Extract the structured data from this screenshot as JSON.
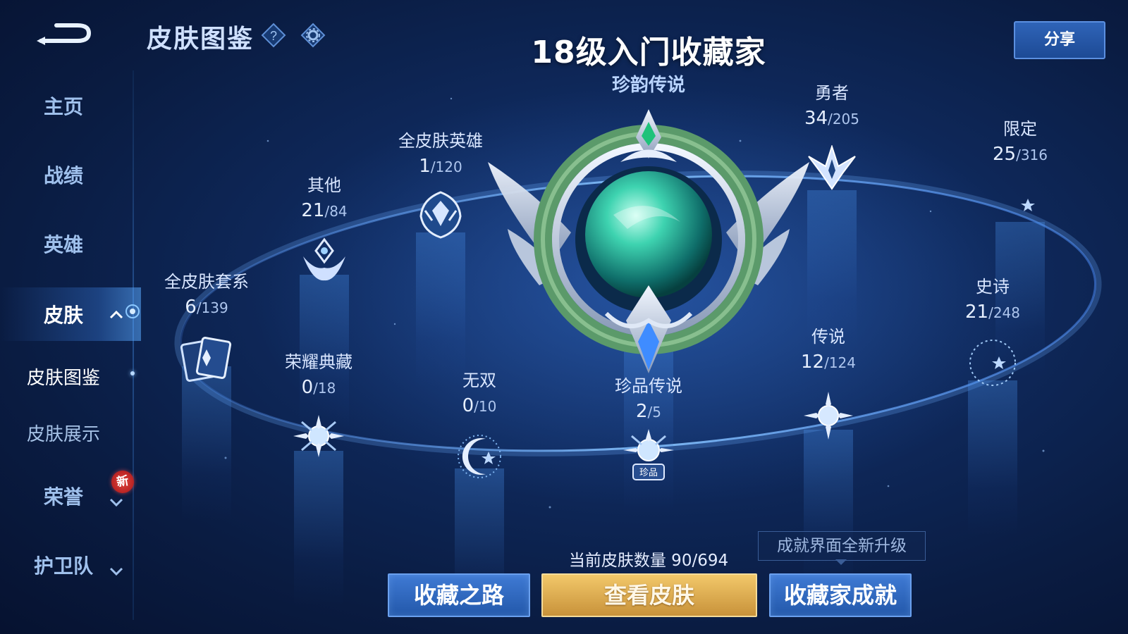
{
  "header": {
    "title": "皮肤图鉴",
    "share_label": "分享",
    "icons": [
      "back-icon",
      "help-icon",
      "settings-icon"
    ]
  },
  "sidebar": {
    "items": [
      {
        "label": "主页"
      },
      {
        "label": "战绩"
      },
      {
        "label": "英雄"
      },
      {
        "label": "皮肤",
        "active": true
      },
      {
        "label": "皮肤图鉴",
        "sub": true,
        "active": true
      },
      {
        "label": "皮肤展示",
        "sub": true
      },
      {
        "label": "荣誉",
        "badge": "新"
      },
      {
        "label": "护卫队"
      }
    ]
  },
  "rank": {
    "title": "18级入门收藏家",
    "tier": "珍韵传说"
  },
  "categories": [
    {
      "label": "全皮肤套系",
      "owned": "6",
      "total": "/139"
    },
    {
      "label": "其他",
      "owned": "21",
      "total": "/84"
    },
    {
      "label": "全皮肤英雄",
      "owned": "1",
      "total": "/120"
    },
    {
      "label": "荣耀典藏",
      "owned": "0",
      "total": "/18"
    },
    {
      "label": "无双",
      "owned": "0",
      "total": "/10"
    },
    {
      "label": "珍品传说",
      "owned": "2",
      "total": "/5",
      "emblem_text": "珍品"
    },
    {
      "label": "勇者",
      "owned": "34",
      "total": "/205"
    },
    {
      "label": "传说",
      "owned": "12",
      "total": "/124"
    },
    {
      "label": "限定",
      "owned": "25",
      "total": "/316"
    },
    {
      "label": "史诗",
      "owned": "21",
      "total": "/248"
    }
  ],
  "footer": {
    "skin_count": "当前皮肤数量 90/694",
    "upgrade_tip": "成就界面全新升级",
    "buttons": {
      "road": "收藏之路",
      "view": "查看皮肤",
      "achieve": "收藏家成就"
    }
  },
  "colors": {
    "accent_blue": "#2f64b8",
    "gold_button": "#f2c86a",
    "badge_red": "#e0433a",
    "orb_green": "#3ed3b0"
  }
}
